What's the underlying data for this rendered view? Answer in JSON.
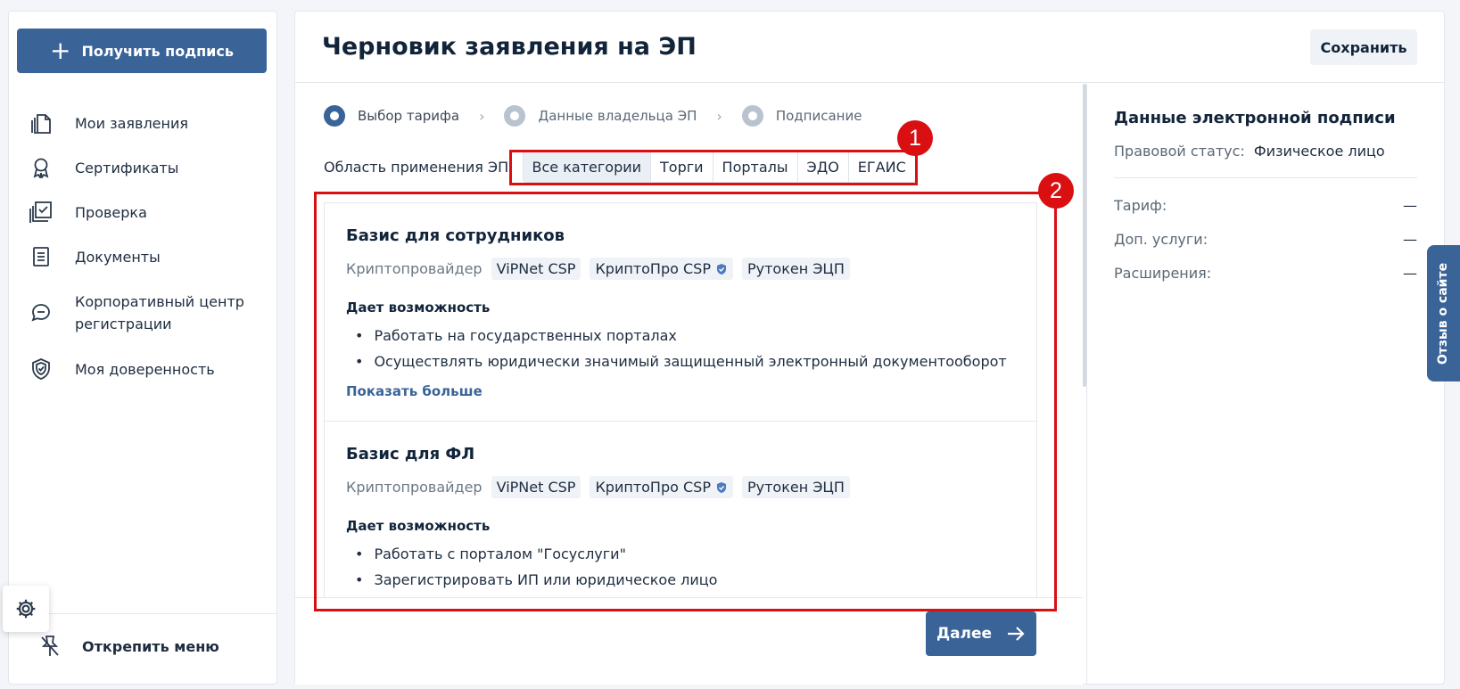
{
  "sidebar": {
    "get_signature_label": "Получить подпись",
    "items": [
      {
        "label": "Мои заявления",
        "icon": "documents-copy-icon"
      },
      {
        "label": "Сертификаты",
        "icon": "award-ribbon-icon"
      },
      {
        "label": "Проверка",
        "icon": "checkbox-stack-icon"
      },
      {
        "label": "Документы",
        "icon": "document-lines-icon"
      },
      {
        "label": "Корпоративный центр регистрации",
        "icon": "chat-bubble-icon"
      },
      {
        "label": "Моя доверенность",
        "icon": "shield-check-icon"
      }
    ],
    "unpin_label": "Открепить меню"
  },
  "header": {
    "title": "Черновик заявления на ЭП",
    "save_label": "Сохранить"
  },
  "stepper": [
    {
      "label": "Выбор тарифа",
      "state": "active"
    },
    {
      "label": "Данные владельца ЭП",
      "state": "inactive"
    },
    {
      "label": "Подписание",
      "state": "inactive"
    }
  ],
  "filter": {
    "label": "Область применения ЭП:",
    "options": [
      "Все категории",
      "Торги",
      "Порталы",
      "ЭДО",
      "ЕГАИС"
    ],
    "selected": "Все категории"
  },
  "tariffs": [
    {
      "title": "Базис для сотрудников",
      "crypto_label": "Криптопровайдер",
      "crypto_options": [
        "ViPNet CSP",
        "КриптоПро CSP",
        "Рутокен ЭЦП"
      ],
      "capabilities_title": "Дает возможность",
      "capabilities": [
        "Работать на государственных порталах",
        "Осуществлять юридически значимый защищенный электронный документооборот"
      ],
      "show_more": "Показать больше"
    },
    {
      "title": "Базис для ФЛ",
      "crypto_label": "Криптопровайдер",
      "crypto_options": [
        "ViPNet CSP",
        "КриптоПро CSP",
        "Рутокен ЭЦП"
      ],
      "capabilities_title": "Дает возможность",
      "capabilities": [
        "Работать с порталом \"Госуслуги\"",
        "Зарегистрировать ИП или юридическое лицо"
      ]
    }
  ],
  "footer": {
    "next_label": "Далее"
  },
  "summary": {
    "title": "Данные электронной подписи",
    "legal_status_key": "Правовой статус:",
    "legal_status_value": "Физическое лицо",
    "rows": [
      {
        "key": "Тариф:",
        "value": "—"
      },
      {
        "key": "Доп. услуги:",
        "value": "—"
      },
      {
        "key": "Расширения:",
        "value": "—"
      }
    ]
  },
  "feedback_label": "Отзыв о сайте",
  "annotations": {
    "badge_1": "1",
    "badge_2": "2",
    "color": "#d90f12"
  },
  "colors": {
    "accent": "#3a6398",
    "background": "#f3f5f8",
    "highlight": "#d90f12"
  }
}
